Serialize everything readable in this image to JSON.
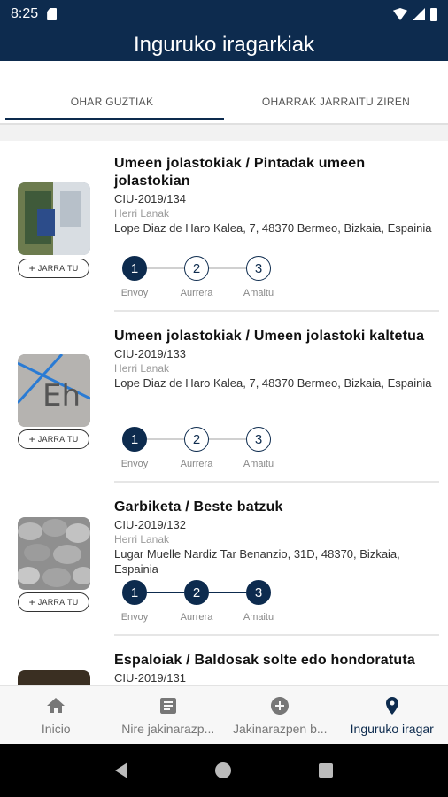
{
  "status": {
    "time": "8:25"
  },
  "app": {
    "title": "Inguruko iragarkiak"
  },
  "tabs": [
    {
      "label": "OHAR GUZTIAK",
      "active": true
    },
    {
      "label": "OHARRAK JARRAITU ZIREN",
      "active": false
    }
  ],
  "follow_label": "JARRAITU",
  "reports": [
    {
      "title": "Umeen jolastokiak / Pintadak umeen jolastokian",
      "code": "CIU-2019/134",
      "dept": "Herri Lanak",
      "address": "Lope Diaz de Haro Kalea, 7, 48370 Bermeo, Bizkaia, Espainia",
      "step_reached": 1,
      "steps": [
        {
          "n": "1",
          "label": "Envoy"
        },
        {
          "n": "2",
          "label": "Aurrera"
        },
        {
          "n": "3",
          "label": "Amaitu"
        }
      ]
    },
    {
      "title": "Umeen jolastokiak / Umeen jolastoki kaltetua",
      "code": "CIU-2019/133",
      "dept": "Herri Lanak",
      "address": "Lope Diaz de Haro Kalea, 7, 48370 Bermeo, Bizkaia, Espainia",
      "step_reached": 1,
      "steps": [
        {
          "n": "1",
          "label": "Envoy"
        },
        {
          "n": "2",
          "label": "Aurrera"
        },
        {
          "n": "3",
          "label": "Amaitu"
        }
      ]
    },
    {
      "title": "Garbiketa / Beste batzuk",
      "code": "CIU-2019/132",
      "dept": "Herri Lanak",
      "address": "Lugar Muelle Nardiz Tar Benanzio, 31D, 48370, Bizkaia, Espainia",
      "step_reached": 3,
      "steps": [
        {
          "n": "1",
          "label": "Envoy"
        },
        {
          "n": "2",
          "label": "Aurrera"
        },
        {
          "n": "3",
          "label": "Amaitu"
        }
      ]
    },
    {
      "title": "Espaloiak / Baldosak solte edo hondoratuta",
      "code": "CIU-2019/131"
    }
  ],
  "bottom_nav": [
    {
      "label": "Inicio",
      "icon": "home-icon",
      "active": false
    },
    {
      "label": "Nire jakinarazp...",
      "icon": "document-icon",
      "active": false
    },
    {
      "label": "Jakinarazpen b...",
      "icon": "add-circle-icon",
      "active": false
    },
    {
      "label": "Inguruko iragar",
      "icon": "location-pin-icon",
      "active": true
    }
  ],
  "colors": {
    "primary": "#0d2b4e",
    "muted_text": "#9a9a9a"
  }
}
